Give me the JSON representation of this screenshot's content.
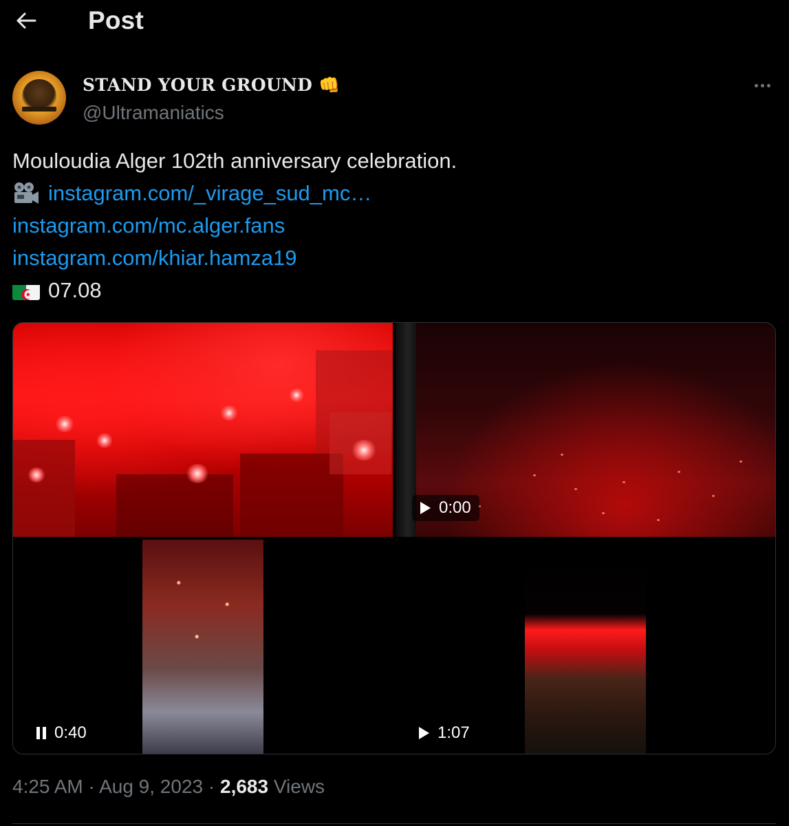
{
  "header": {
    "title": "Post",
    "back_icon": "arrow-left-icon"
  },
  "author": {
    "display_name": "STAND YOUR GROUND 👊",
    "handle": "@Ultramaniatics",
    "avatar_icon": "avatar-image",
    "more_icon": "more-horizontal-icon"
  },
  "post": {
    "text_line": "Mouloudia Alger 102th anniversary celebration.",
    "link_1": "instagram.com/_virage_sud_mc…",
    "link_2": "instagram.com/mc.alger.fans",
    "link_3": "instagram.com/khiar.hamza19",
    "date_text": "07.08",
    "film_icon": "film-camera-icon",
    "flag_icon": "algeria-flag-icon"
  },
  "media": {
    "items": [
      {
        "kind": "image"
      },
      {
        "kind": "video",
        "time": "0:00",
        "control": "play"
      },
      {
        "kind": "video",
        "time": "0:40",
        "control": "pause"
      },
      {
        "kind": "video",
        "time": "1:07",
        "control": "play"
      }
    ]
  },
  "meta": {
    "time": "4:25 AM",
    "separator": "·",
    "date": "Aug 9, 2023",
    "views_count": "2,683",
    "views_label": "Views"
  },
  "colors": {
    "background": "#000000",
    "text": "#e7e9ea",
    "muted": "#71767b",
    "link": "#1d9bf0",
    "border": "#2f3336"
  }
}
